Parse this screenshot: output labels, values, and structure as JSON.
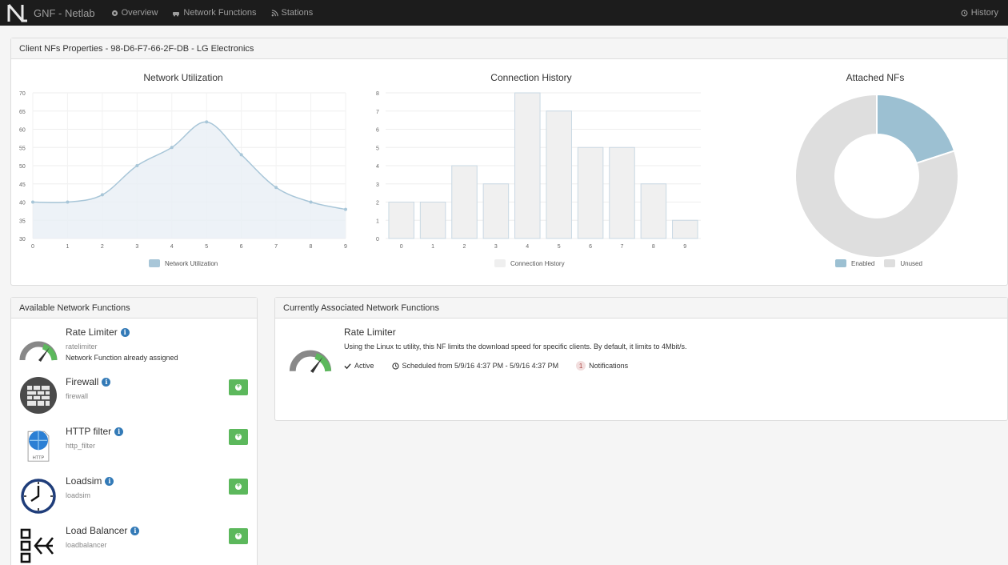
{
  "app": {
    "title": "GNF - Netlab",
    "nav": [
      {
        "label": "Overview",
        "icon": "dashboard-icon"
      },
      {
        "label": "Network Functions",
        "icon": "cars-icon"
      },
      {
        "label": "Stations",
        "icon": "rss-icon"
      }
    ],
    "history_label": "History"
  },
  "props": {
    "heading": "Client NFs Properties - 98-D6-F7-66-2F-DB - LG Electronics"
  },
  "chart_data": [
    {
      "type": "area",
      "title": "Network Utilization",
      "x": [
        0,
        1,
        2,
        3,
        4,
        5,
        6,
        7,
        8,
        9
      ],
      "series": [
        {
          "name": "Network Utilization",
          "values": [
            40,
            40,
            42,
            50,
            55,
            62,
            53,
            44,
            40,
            38
          ]
        }
      ],
      "ylim": [
        30,
        70
      ],
      "yticks": [
        30,
        35,
        40,
        45,
        50,
        55,
        60,
        65,
        70
      ],
      "color": "#a8c6d8",
      "grid": true,
      "legend": "bottom"
    },
    {
      "type": "bar",
      "title": "Connection History",
      "categories": [
        "0",
        "1",
        "2",
        "3",
        "4",
        "5",
        "6",
        "7",
        "8",
        "9"
      ],
      "series": [
        {
          "name": "Connection History",
          "values": [
            2,
            2,
            4,
            3,
            8,
            7,
            5,
            5,
            3,
            1
          ]
        }
      ],
      "ylim": [
        0,
        8
      ],
      "yticks": [
        0,
        1,
        2,
        3,
        4,
        5,
        6,
        7,
        8
      ],
      "color": "#dcdcdc",
      "grid": true,
      "legend": "bottom"
    },
    {
      "type": "pie",
      "title": "Attached NFs",
      "labels": [
        "Enabled",
        "Unused"
      ],
      "values": [
        1,
        4
      ],
      "colors": [
        "#9cc0d2",
        "#dedede"
      ],
      "legend": "bottom"
    }
  ],
  "available": {
    "heading": "Available Network Functions",
    "items": [
      {
        "name": "Rate Limiter",
        "id": "ratelimiter",
        "note": "Network Function already assigned",
        "icon": "gauge-icon",
        "has_add": false
      },
      {
        "name": "Firewall",
        "id": "firewall",
        "note": "",
        "icon": "firewall-icon",
        "has_add": true
      },
      {
        "name": "HTTP filter",
        "id": "http_filter",
        "note": "",
        "icon": "http-file-icon",
        "has_add": true
      },
      {
        "name": "Loadsim",
        "id": "loadsim",
        "note": "",
        "icon": "clock-icon",
        "has_add": true
      },
      {
        "name": "Load Balancer",
        "id": "loadbalancer",
        "note": "",
        "icon": "load-balancer-icon",
        "has_add": true
      }
    ],
    "http_badge": "HTTP"
  },
  "associated": {
    "heading": "Currently Associated Network Functions",
    "name": "Rate Limiter",
    "description": "Using the Linux tc utility, this NF limits the download speed for specific clients. By default, it limits to 4Mbit/s.",
    "status": "Active",
    "schedule": "Scheduled from 5/9/16 4:37 PM - 5/9/16 4:37 PM",
    "notifications_count": "1",
    "notifications_label": "Notifications"
  }
}
